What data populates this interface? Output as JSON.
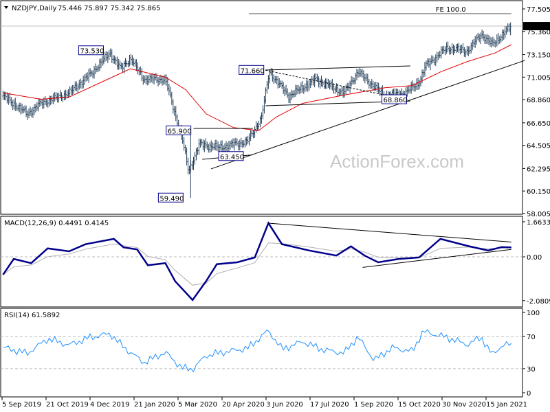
{
  "header": {
    "symbol": "NZDJPY,Daily",
    "ohlc": "75.446 75.897 75.342 75.865"
  },
  "watermark": "ActionForex.com",
  "colors": {
    "bars": "#1f3b57",
    "sma": "#e00000",
    "macd": "#00008b",
    "signal": "#b0b0b0",
    "rsi": "#1e90ff",
    "annotation_border": "#00008b",
    "trendline": "#000000"
  },
  "chart_data": [
    {
      "type": "bar",
      "title": "NZDJPY,Daily",
      "ylim": [
        58.005,
        77.505
      ],
      "y_ticks": [
        "77.505",
        "75.360",
        "73.150",
        "71.005",
        "68.860",
        "66.650",
        "64.505",
        "62.295",
        "60.150",
        "58.005"
      ],
      "current_price": "75.865",
      "x_ticks": [
        "5 Sep 2019",
        "21 Oct 2019",
        "4 Dec 2019",
        "21 Jan 2020",
        "5 Mar 2020",
        "20 Apr 2020",
        "3 Jun 2020",
        "17 Jul 2020",
        "1 Sep 2020",
        "15 Oct 2020",
        "30 Nov 2020",
        "15 Jan 2021"
      ],
      "close": [
        [
          "2019-09-06",
          69.2
        ],
        [
          "2019-10-01",
          67.5
        ],
        [
          "2019-10-15",
          68.5
        ],
        [
          "2019-11-13",
          69.5
        ],
        [
          "2019-12-04",
          71.2
        ],
        [
          "2019-12-25",
          73.3
        ],
        [
          "2020-01-05",
          71.8
        ],
        [
          "2020-01-15",
          72.8
        ],
        [
          "2020-01-29",
          70.8
        ],
        [
          "2020-02-20",
          70.8
        ],
        [
          "2020-03-01",
          67.5
        ],
        [
          "2020-03-08",
          65.3
        ],
        [
          "2020-03-15",
          62.0
        ],
        [
          "2020-03-26",
          64.6
        ],
        [
          "2020-04-16",
          64.3
        ],
        [
          "2020-05-15",
          64.9
        ],
        [
          "2020-05-29",
          67.2
        ],
        [
          "2020-06-06",
          71.5
        ],
        [
          "2020-06-26",
          69.2
        ],
        [
          "2020-07-24",
          70.8
        ],
        [
          "2020-08-22",
          69.5
        ],
        [
          "2020-09-05",
          71.5
        ],
        [
          "2020-10-03",
          69.2
        ],
        [
          "2020-10-24",
          69.5
        ],
        [
          "2020-11-07",
          70.5
        ],
        [
          "2020-11-14",
          72.1
        ],
        [
          "2020-12-06",
          73.8
        ],
        [
          "2020-12-27",
          73.5
        ],
        [
          "2021-01-10",
          75.1
        ],
        [
          "2021-01-21",
          74.1
        ],
        [
          "2021-02-10",
          75.865
        ]
      ],
      "sma": {
        "values": [
          [
            "2019-09-06",
            69.5
          ],
          [
            "2019-10-15",
            68.9
          ],
          [
            "2019-11-13",
            69.1
          ],
          [
            "2019-12-18",
            70.6
          ],
          [
            "2020-01-15",
            71.8
          ],
          [
            "2020-02-20",
            71.0
          ],
          [
            "2020-03-12",
            69.8
          ],
          [
            "2020-04-02",
            67.5
          ],
          [
            "2020-04-30",
            66.2
          ],
          [
            "2020-05-26",
            65.9
          ],
          [
            "2020-06-13",
            67.2
          ],
          [
            "2020-07-10",
            68.5
          ],
          [
            "2020-08-22",
            69.3
          ],
          [
            "2020-10-03",
            70.0
          ],
          [
            "2020-10-31",
            70.2
          ],
          [
            "2020-11-29",
            71.5
          ],
          [
            "2020-12-27",
            72.5
          ],
          [
            "2021-01-24",
            73.3
          ],
          [
            "2021-02-10",
            74.1
          ]
        ]
      },
      "annotations": [
        {
          "text": "73.530",
          "date": "2019-12-19",
          "price": 73.53
        },
        {
          "text": "71.660",
          "date": "2020-06-01",
          "price": 71.66
        },
        {
          "text": "65.900",
          "date": "2020-03-18",
          "price": 65.9
        },
        {
          "text": "63.450",
          "date": "2020-05-11",
          "price": 63.45
        },
        {
          "text": "68.860",
          "date": "2020-10-26",
          "price": 68.86
        },
        {
          "text": "59.490",
          "date": "2020-03-10",
          "price": 59.49
        }
      ],
      "fe_line": {
        "text": "FE 100.0",
        "from": "2020-05-16",
        "to": "2021-02-10",
        "price": 77.05
      },
      "trendlines": [
        {
          "from": [
            "2020-04-07",
            62.26
          ],
          "to": [
            "2021-02-24",
            72.6
          ]
        },
        {
          "from": [
            "2020-06-02",
            71.68
          ],
          "to": [
            "2020-10-29",
            72.07
          ]
        },
        {
          "from": [
            "2020-06-02",
            68.28
          ],
          "to": [
            "2020-10-29",
            68.73
          ]
        },
        {
          "from": [
            "2020-03-20",
            66.12
          ],
          "to": [
            "2020-05-20",
            66.12
          ]
        },
        {
          "from": [
            "2020-03-29",
            63.17
          ],
          "to": [
            "2020-05-20",
            63.6
          ]
        }
      ]
    },
    {
      "type": "line",
      "title": "MACD(12,26,9) 0.4491 0.4145",
      "ylim": [
        -2.0809,
        1.6633
      ],
      "y_ticks": [
        "1.6633",
        "0.00",
        "-2.0809"
      ],
      "macd": [
        [
          "2019-09-06",
          -0.85
        ],
        [
          "2019-09-17",
          -0.1
        ],
        [
          "2019-10-05",
          -0.3
        ],
        [
          "2019-10-22",
          0.4
        ],
        [
          "2019-11-13",
          0.26
        ],
        [
          "2019-11-30",
          0.6
        ],
        [
          "2019-12-29",
          0.85
        ],
        [
          "2020-01-08",
          0.45
        ],
        [
          "2020-01-22",
          0.35
        ],
        [
          "2020-02-02",
          -0.4
        ],
        [
          "2020-02-20",
          -0.3
        ],
        [
          "2020-03-01",
          -1.15
        ],
        [
          "2020-03-19",
          -2.05
        ],
        [
          "2020-04-02",
          -1.15
        ],
        [
          "2020-04-13",
          -0.35
        ],
        [
          "2020-05-04",
          -0.26
        ],
        [
          "2020-05-22",
          -0.03
        ],
        [
          "2020-06-05",
          1.6
        ],
        [
          "2020-06-19",
          0.6
        ],
        [
          "2020-07-17",
          0.3
        ],
        [
          "2020-08-14",
          0.06
        ],
        [
          "2020-08-29",
          0.5
        ],
        [
          "2020-09-12",
          0.06
        ],
        [
          "2020-09-26",
          -0.26
        ],
        [
          "2020-10-17",
          -0.1
        ],
        [
          "2020-11-07",
          -0.03
        ],
        [
          "2020-11-29",
          0.85
        ],
        [
          "2020-12-27",
          0.52
        ],
        [
          "2021-01-17",
          0.3
        ],
        [
          "2021-01-31",
          0.46
        ],
        [
          "2021-02-10",
          0.4491
        ]
      ],
      "signal_last": 0.4145
    },
    {
      "type": "line",
      "title": "RSI(14) 61.5892",
      "ylim": [
        0,
        100
      ],
      "levels": [
        70,
        30
      ],
      "y_ticks": [
        "100",
        "70",
        "30",
        "0"
      ],
      "rsi": [
        [
          "2019-09-06",
          55
        ],
        [
          "2019-10-01",
          48
        ],
        [
          "2019-10-22",
          67
        ],
        [
          "2019-11-13",
          60
        ],
        [
          "2019-12-04",
          70
        ],
        [
          "2019-12-25",
          75
        ],
        [
          "2020-01-08",
          58
        ],
        [
          "2020-01-29",
          38
        ],
        [
          "2020-02-20",
          50
        ],
        [
          "2020-03-08",
          30
        ],
        [
          "2020-03-19",
          28
        ],
        [
          "2020-04-02",
          45
        ],
        [
          "2020-04-23",
          50
        ],
        [
          "2020-05-15",
          55
        ],
        [
          "2020-06-05",
          78
        ],
        [
          "2020-06-19",
          55
        ],
        [
          "2020-07-10",
          65
        ],
        [
          "2020-07-31",
          55
        ],
        [
          "2020-08-22",
          50
        ],
        [
          "2020-09-05",
          70
        ],
        [
          "2020-09-22",
          40
        ],
        [
          "2020-10-10",
          55
        ],
        [
          "2020-10-31",
          50
        ],
        [
          "2020-11-11",
          75
        ],
        [
          "2020-12-06",
          68
        ],
        [
          "2020-12-27",
          60
        ],
        [
          "2021-01-10",
          70
        ],
        [
          "2021-01-21",
          48
        ],
        [
          "2021-01-31",
          60
        ],
        [
          "2021-02-10",
          61.5892
        ]
      ]
    }
  ]
}
